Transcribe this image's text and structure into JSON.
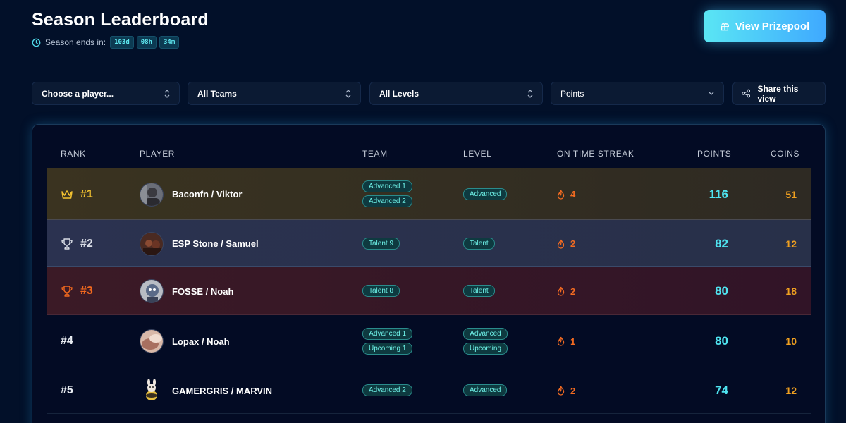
{
  "header": {
    "title": "Season Leaderboard",
    "season_label": "Season ends in:",
    "countdown": [
      "103d",
      "08h",
      "34m"
    ],
    "prize_button": "View Prizepool"
  },
  "filters": {
    "player": "Choose a player...",
    "team": "All Teams",
    "level": "All Levels",
    "sort": "Points",
    "share": "Share this view"
  },
  "table": {
    "columns": [
      "RANK",
      "PLAYER",
      "TEAM",
      "LEVEL",
      "ON TIME STREAK",
      "POINTS",
      "COINS"
    ],
    "rows": [
      {
        "rank": "#1",
        "player": "Baconfn / Viktor",
        "teams": [
          "Advanced 1",
          "Advanced 2"
        ],
        "levels": [
          "Advanced"
        ],
        "streak": "4",
        "points": "116",
        "coins": "51"
      },
      {
        "rank": "#2",
        "player": "ESP Stone / Samuel",
        "teams": [
          "Talent 9"
        ],
        "levels": [
          "Talent"
        ],
        "streak": "2",
        "points": "82",
        "coins": "12"
      },
      {
        "rank": "#3",
        "player": "FOSSE / Noah",
        "teams": [
          "Talent 8"
        ],
        "levels": [
          "Talent"
        ],
        "streak": "2",
        "points": "80",
        "coins": "18"
      },
      {
        "rank": "#4",
        "player": "Lopax / Noah",
        "teams": [
          "Advanced 1",
          "Upcoming 1"
        ],
        "levels": [
          "Advanced",
          "Upcoming"
        ],
        "streak": "1",
        "points": "80",
        "coins": "10"
      },
      {
        "rank": "#5",
        "player": "GAMERGRIS / MARVIN",
        "teams": [
          "Advanced 2"
        ],
        "levels": [
          "Advanced"
        ],
        "streak": "2",
        "points": "74",
        "coins": "12"
      }
    ]
  },
  "colors": {
    "background": "#021029",
    "accent_cyan": "#4fe4f0",
    "gold": "#f2c230",
    "bronze": "#f2691e",
    "coins": "#f0a020"
  },
  "icons": {
    "clock": "clock-icon",
    "gift": "gift-icon",
    "chevron": "chevron-updown-icon",
    "share": "share-icon",
    "crown": "crown-icon",
    "trophy": "trophy-icon",
    "flame": "flame-icon"
  }
}
